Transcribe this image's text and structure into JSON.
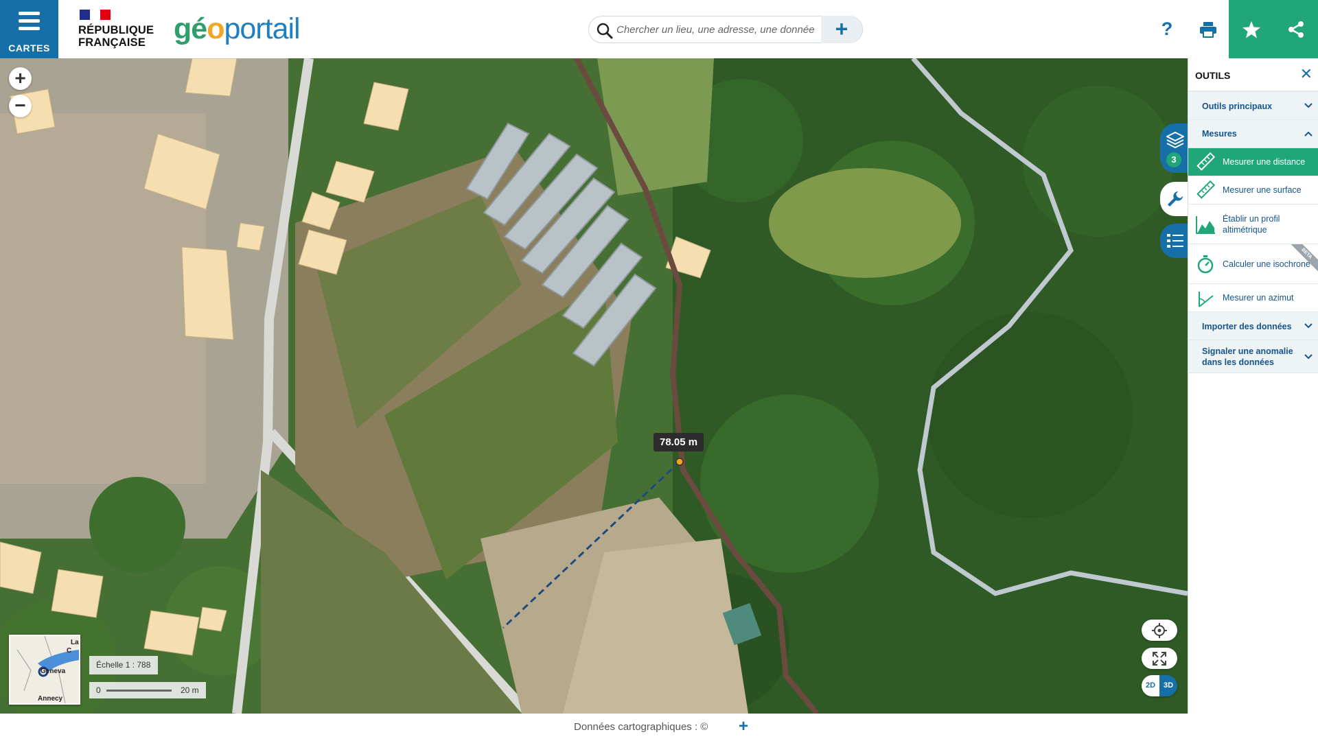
{
  "header": {
    "menu_label": "CARTES",
    "rf_line1": "RÉPUBLIQUE",
    "rf_line2": "FRANÇAISE",
    "logo_g": "gé",
    "logo_o": "o",
    "logo_portail": "portail",
    "search_placeholder": "Chercher un lieu, une adresse, une donnée",
    "search_plus": "+",
    "help_label": "?"
  },
  "map": {
    "zoom_in": "+",
    "zoom_out": "−",
    "measure_label": "78.05 m",
    "overview_labels": {
      "top_right": "La",
      "city": "Geneva",
      "bottom": "Annecy",
      "small": "C"
    },
    "scale_text": "Échelle 1 : 788",
    "scale_zero": "0",
    "scale_max": "20 m",
    "dim_2d": "2D",
    "dim_3d": "3D",
    "layers_count": "3"
  },
  "panel": {
    "title": "OUTILS",
    "close": "✕",
    "sections": {
      "outils_principaux": "Outils principaux",
      "mesures": "Mesures",
      "importer": "Importer des données",
      "signaler": "Signaler une anomalie dans les données"
    },
    "tools": [
      {
        "label": "Mesurer une distance",
        "active": true
      },
      {
        "label": "Mesurer une surface",
        "active": false
      },
      {
        "label": "Établir un profil altimétrique",
        "active": false
      },
      {
        "label": "Calculer une isochrone",
        "active": false,
        "badge": "BETA"
      },
      {
        "label": "Mesurer un azimut",
        "active": false
      }
    ]
  },
  "footer": {
    "credits": "Données cartographiques : ©",
    "more": "+"
  },
  "colors": {
    "primary_blue": "#166fa7",
    "accent_green": "#21a67a",
    "path_brown": "#6b4a3f"
  }
}
